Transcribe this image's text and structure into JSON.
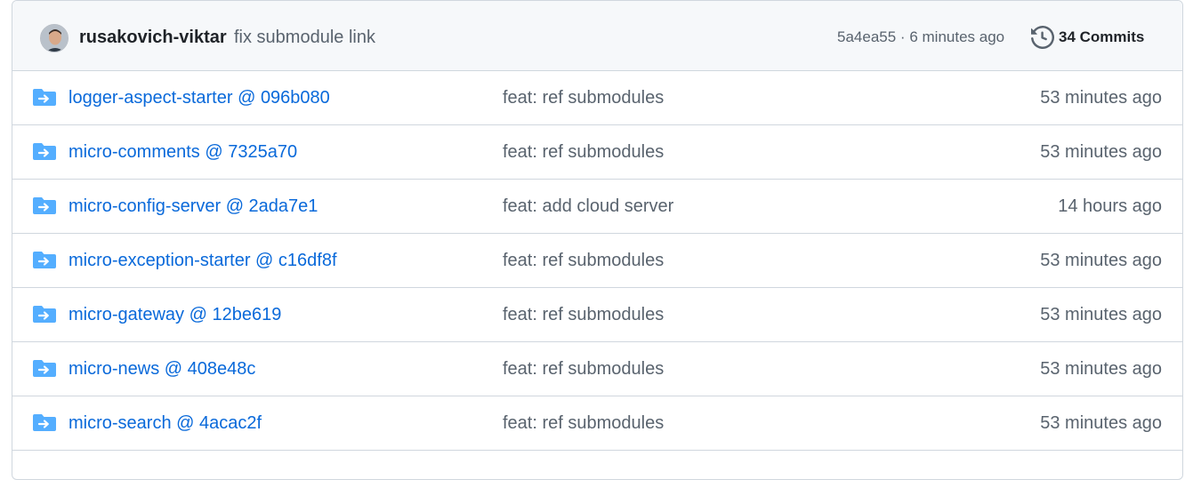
{
  "latest_commit": {
    "author": "rusakovich-viktar",
    "message": "fix submodule link",
    "hash": "5a4ea55",
    "separator": "·",
    "time": "6 minutes ago",
    "commits_label": "34 Commits",
    "history_icon": "history-icon"
  },
  "colors": {
    "link": "#0969da",
    "folder": "#54aeff",
    "muted": "#59636e"
  },
  "files": [
    {
      "name": "logger-aspect-starter @ 096b080",
      "message": "feat: ref submodules",
      "time": "53 minutes ago",
      "icon": "submodule-folder-icon"
    },
    {
      "name": "micro-comments @ 7325a70",
      "message": "feat: ref submodules",
      "time": "53 minutes ago",
      "icon": "submodule-folder-icon"
    },
    {
      "name": "micro-config-server @ 2ada7e1",
      "message": "feat: add cloud server",
      "time": "14 hours ago",
      "icon": "submodule-folder-icon"
    },
    {
      "name": "micro-exception-starter @ c16df8f",
      "message": "feat: ref submodules",
      "time": "53 minutes ago",
      "icon": "submodule-folder-icon"
    },
    {
      "name": "micro-gateway @ 12be619",
      "message": "feat: ref submodules",
      "time": "53 minutes ago",
      "icon": "submodule-folder-icon"
    },
    {
      "name": "micro-news @ 408e48c",
      "message": "feat: ref submodules",
      "time": "53 minutes ago",
      "icon": "submodule-folder-icon"
    },
    {
      "name": "micro-search @ 4acac2f",
      "message": "feat: ref submodules",
      "time": "53 minutes ago",
      "icon": "submodule-folder-icon"
    }
  ]
}
